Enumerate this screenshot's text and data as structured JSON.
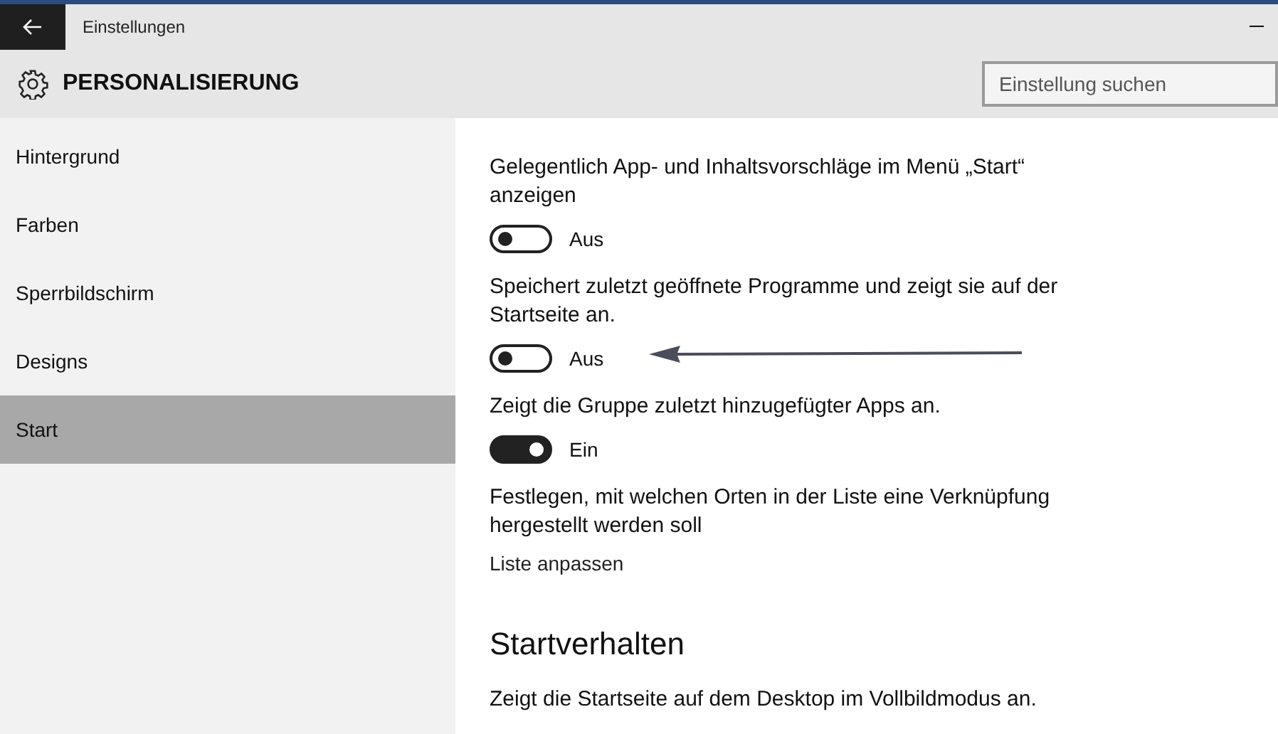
{
  "window": {
    "title": "Einstellungen"
  },
  "header": {
    "title": "PERSONALISIERUNG",
    "search": {
      "placeholder": "Einstellung suchen"
    }
  },
  "sidebar": {
    "items": [
      {
        "label": "Hintergrund",
        "selected": false
      },
      {
        "label": "Farben",
        "selected": false
      },
      {
        "label": "Sperrbildschirm",
        "selected": false
      },
      {
        "label": "Designs",
        "selected": false
      },
      {
        "label": "Start",
        "selected": true
      }
    ]
  },
  "settings": [
    {
      "kind": "toggle",
      "description": "Gelegentlich App- und Inhaltsvorschläge im Menü „Start“ anzeigen",
      "on": false,
      "state_label": "Aus",
      "annotated": false
    },
    {
      "kind": "toggle",
      "description": "Speichert zuletzt geöffnete Programme und zeigt sie auf der Startseite an.",
      "on": false,
      "state_label": "Aus",
      "annotated": true
    },
    {
      "kind": "toggle",
      "description": "Zeigt die Gruppe zuletzt hinzugefügter Apps an.",
      "on": true,
      "state_label": "Ein",
      "annotated": false
    },
    {
      "kind": "link",
      "description": "Festlegen, mit welchen Orten in der Liste eine Verknüpfung hergestellt werden soll",
      "link": "Liste anpassen"
    }
  ],
  "section": {
    "heading": "Startverhalten",
    "description": "Zeigt die Startseite auf dem Desktop im Vollbildmodus an."
  }
}
